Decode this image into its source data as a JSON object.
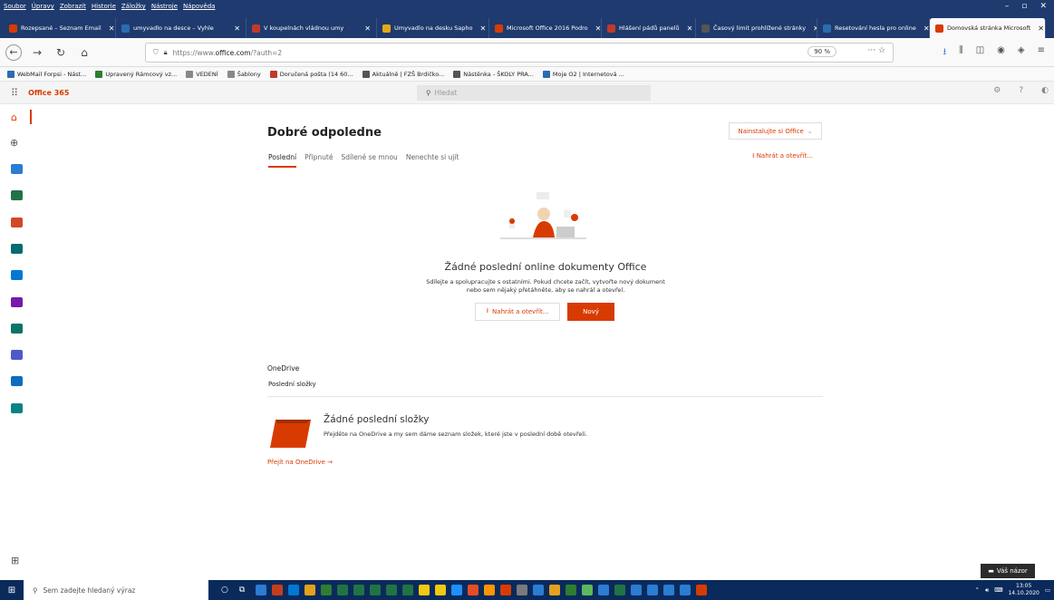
{
  "menubar": {
    "items": [
      "Soubor",
      "Úpravy",
      "Zobrazit",
      "Historie",
      "Záložky",
      "Nástroje",
      "Nápověda"
    ]
  },
  "tabs": [
    {
      "label": "Rozepsané – Seznam Email",
      "color": "#d83b01"
    },
    {
      "label": "umyvadlo na desce – Vyhle",
      "color": "#2b6cb0"
    },
    {
      "label": "V koupelnách vládnou umy",
      "color": "#c0392b"
    },
    {
      "label": "Umyvadlo na desku Sapho",
      "color": "#e6a817"
    },
    {
      "label": "Microsoft Office 2016 Podro",
      "color": "#d83b01"
    },
    {
      "label": "Hlášení pádů panelů",
      "color": "#c0392b"
    },
    {
      "label": "Časový limit prohlížené stránky",
      "color": "#555555"
    },
    {
      "label": "Resetování hesla pro online",
      "color": "#2b6cb0"
    },
    {
      "label": "Domovská stránka Microsoft",
      "color": "#d83b01",
      "active": true
    }
  ],
  "nav": {
    "url_prefix": "https://www.",
    "url_domain": "office.com",
    "url_path": "/?auth=2",
    "zoom": "90 %"
  },
  "bookmarks": [
    {
      "label": "WebMail Forpsi - Nást...",
      "color": "#2b6cb0"
    },
    {
      "label": "Upravený Rámcový vz...",
      "color": "#2e7d32"
    },
    {
      "label": "VEDENÍ",
      "color": "#888888"
    },
    {
      "label": "Šablony",
      "color": "#888888"
    },
    {
      "label": "Doručená pošta (14 60...",
      "color": "#c0392b"
    },
    {
      "label": "Aktuálně | FZŠ Brdičko...",
      "color": "#555555"
    },
    {
      "label": "Nástěnka - ŠKOLY PRA...",
      "color": "#555555"
    },
    {
      "label": "Moje O2 | Internetová ...",
      "color": "#2b6cb0"
    }
  ],
  "o365": {
    "brand": "Office 365",
    "search_placeholder": "Hledat"
  },
  "main": {
    "greeting": "Dobré odpoledne",
    "install_label": "Nainstalujte si Office",
    "subtabs": [
      "Poslední",
      "Připnuté",
      "Sdílené se mnou",
      "Nenechte si ujít"
    ],
    "upload_label": "Nahrát a otevřít...",
    "empty_title": "Žádné poslední online dokumenty Office",
    "empty_desc_1": "Sdílejte a spolupracujte s ostatními. Pokud chcete začít, vytvořte nový dokument",
    "empty_desc_2": "nebo sem nějaký přetáhněte, aby se nahrál a otevřel.",
    "btn_upload": "Nahrát a otevřít...",
    "btn_new": "Nový",
    "onedrive_title": "OneDrive",
    "onedrive_sub": "Poslední složky",
    "folders_title": "Žádné poslední složky",
    "folders_desc": "Přejděte na OneDrive a my sem dáme seznam složek, které jste v poslední době otevřeli.",
    "goto_onedrive": "Přejít na OneDrive →"
  },
  "rail_colors": [
    "#2b7cd3",
    "#217346",
    "#d24726",
    "#036c70",
    "#0078d4",
    "#7719aa",
    "#077568",
    "#5059c9",
    "#0f6cbd",
    "#038387"
  ],
  "feedback": "Váš názor",
  "taskbar": {
    "search_placeholder": "Sem zadejte hledaný výraz",
    "time": "13:05",
    "date": "14.10.2020",
    "icon_colors": [
      "#2b7cd3",
      "#c43e1c",
      "#0078d4",
      "#e4a11b",
      "#2e7d32",
      "#217346",
      "#217346",
      "#217346",
      "#217346",
      "#217346",
      "#f2c811",
      "#f2c811",
      "#1e90ff",
      "#e44d26",
      "#ff9500",
      "#d83b01",
      "#7a7a7a",
      "#2b7cd3",
      "#e4a11b",
      "#2e7d32",
      "#5cb85c",
      "#2b7cd3",
      "#217346",
      "#2b7cd3",
      "#2b7cd3",
      "#2b7cd3",
      "#2b7cd3",
      "#d83b01"
    ]
  }
}
